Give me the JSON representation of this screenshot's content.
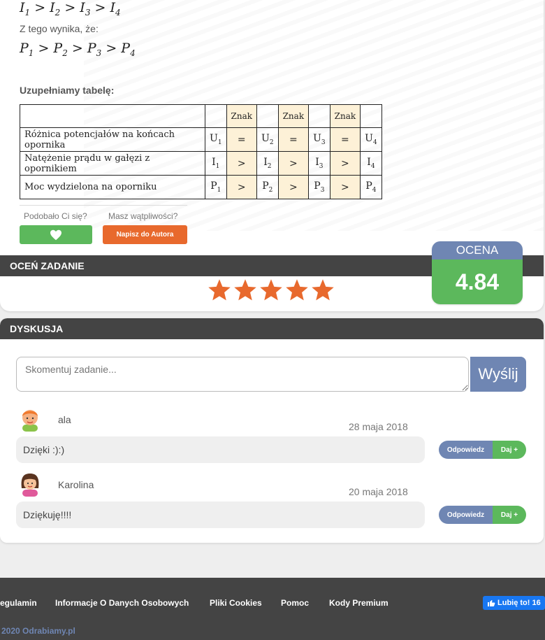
{
  "solution": {
    "line1_parts": [
      "I",
      "1",
      " > I",
      "2",
      " > I",
      "3",
      " > I",
      "4"
    ],
    "intro": "Z tego wynika, że:",
    "line2_parts": [
      "P",
      "1",
      " > P",
      "2",
      " > P",
      "3",
      " > P",
      "4"
    ],
    "fill_heading": "Uzupełniamy tabelę:"
  },
  "table": {
    "sign_header": "Znak",
    "rows": [
      {
        "label": "Różnica potencjałów na końcach opornika",
        "letter": "U",
        "signs": [
          "=",
          "=",
          "="
        ]
      },
      {
        "label": "Natężenie prądu w gałęzi z opornikiem",
        "letter": "I",
        "signs": [
          ">",
          ">",
          ">"
        ]
      },
      {
        "label": "Moc wydzielona na oporniku",
        "letter": "P",
        "signs": [
          ">",
          ">",
          ">"
        ]
      }
    ],
    "subscripts": [
      "1",
      "2",
      "3",
      "4"
    ]
  },
  "feedback": {
    "liked_label": "Podobało Ci się?",
    "doubts_label": "Masz wątpliwości?",
    "author_button": "Napisz do Autora"
  },
  "rate": {
    "bar_title": "OCEŃ ZADANIE",
    "stars_count": 5,
    "star_color": "#e8692d",
    "box_title": "OCENA",
    "value": "4.84"
  },
  "discussion": {
    "bar_title": "DYSKUSJA",
    "placeholder": "Skomentuj zadanie...",
    "send_label": "Wyślij",
    "comments": [
      {
        "user": "ala",
        "date": "28 maja 2018",
        "text": "Dzięki :):)",
        "reply": "Odpowiedz",
        "give": "Daj +"
      },
      {
        "user": "Karolina",
        "date": "20 maja 2018",
        "text": "Dziękuję!!!!",
        "reply": "Odpowiedz",
        "give": "Daj +"
      }
    ]
  },
  "footer": {
    "links": [
      "egulamin",
      "Informacje O Danych Osobowych",
      "Pliki Cookies",
      "Pomoc",
      "Kody Premium"
    ],
    "fb_label": "Lubię to! 16",
    "copyright": "2020 Odrabiamy.pl"
  },
  "colors": {
    "green": "#5cb85c",
    "orange": "#e8692d",
    "blue": "#6f86b3",
    "dark_bar": "#444444",
    "facebook": "#1877f2"
  }
}
